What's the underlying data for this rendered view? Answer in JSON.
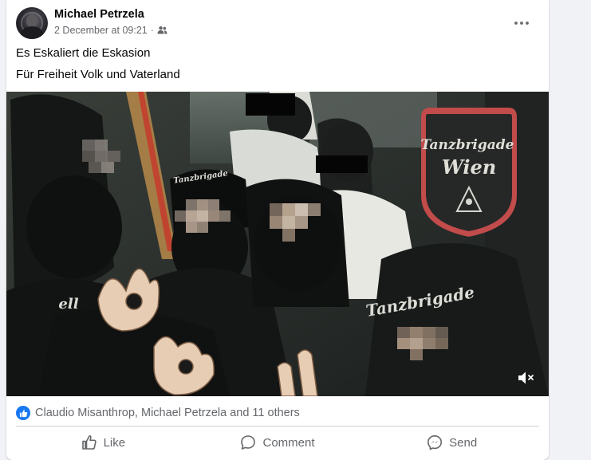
{
  "post": {
    "author": "Michael Petrzela",
    "timestamp": "2 December at 09:21",
    "separator": "·",
    "audience_icon": "friends-icon",
    "text_line1": "Es Eskaliert die Eskasion",
    "text_line2": "Für Freiheit Volk und Vaterland"
  },
  "image": {
    "patch_line1": "Tanzbrigade",
    "patch_line2": "Wien",
    "cap_text": "Tanzbrigade",
    "jacket_text": "Tanzbrigade",
    "sleeve_text": "ell",
    "mute_icon": "speaker-muted-icon"
  },
  "reactions": {
    "summary": "Claudio Misanthrop, Michael Petrzela and 11 others",
    "icon": "like-reaction-icon",
    "color": "#1877f2"
  },
  "actions": {
    "like_label": "Like",
    "comment_label": "Comment",
    "send_label": "Send"
  }
}
